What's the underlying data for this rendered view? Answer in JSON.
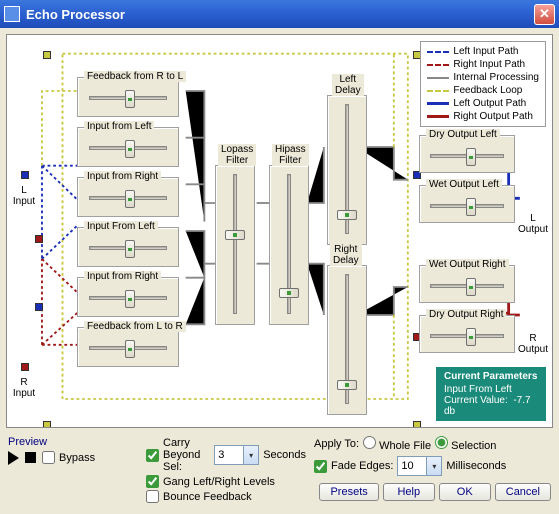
{
  "title": "Echo Processor",
  "legend": {
    "items": [
      {
        "label": "Left Input Path",
        "color": "#1a2fb8",
        "style": "dashed"
      },
      {
        "label": "Right Input Path",
        "color": "#a01818",
        "style": "dashed"
      },
      {
        "label": "Internal Processing",
        "color": "#888888",
        "style": "solid"
      },
      {
        "label": "Feedback Loop",
        "color": "#c8c840",
        "style": "dashed"
      },
      {
        "label": "Left Output Path",
        "color": "#1a2fb8",
        "style": "solid"
      },
      {
        "label": "Right Output Path",
        "color": "#a01818",
        "style": "solid"
      }
    ]
  },
  "side_labels": {
    "l_input": "L\nInput",
    "r_input": "R\nInput",
    "l_output": "L\nOutput",
    "r_output": "R\nOutput"
  },
  "boxes": {
    "fb_rl": "Feedback from R to L",
    "in_left_1": "Input from Left",
    "in_right_1": "Input from Right",
    "in_left_2": "Input From Left",
    "in_right_2": "Input from Right",
    "fb_lr": "Feedback from L to R",
    "lopass": "Lopass\nFilter",
    "hipass": "Hipass\nFilter",
    "left_delay": "Left\nDelay",
    "right_delay": "Right\nDelay",
    "dry_left": "Dry Output Left",
    "wet_left": "Wet Output Left",
    "wet_right": "Wet Output Right",
    "dry_right": "Dry Output Right"
  },
  "current_params": {
    "heading": "Current Parameters",
    "name": "Input From Left",
    "label": "Current Value:",
    "value": "-7.7 db"
  },
  "preview": {
    "label": "Preview",
    "bypass": "Bypass"
  },
  "checks": {
    "carry": "Carry Beyond Sel:",
    "seconds": "Seconds",
    "gang": "Gang Left/Right Levels",
    "bounce": "Bounce Feedback",
    "fade": "Fade Edges:",
    "ms": "Milliseconds"
  },
  "carry_value": "3",
  "fade_value": "10",
  "apply_to": {
    "label": "Apply To:",
    "whole": "Whole File",
    "selection": "Selection"
  },
  "buttons": {
    "presets": "Presets",
    "help": "Help",
    "ok": "OK",
    "cancel": "Cancel"
  }
}
